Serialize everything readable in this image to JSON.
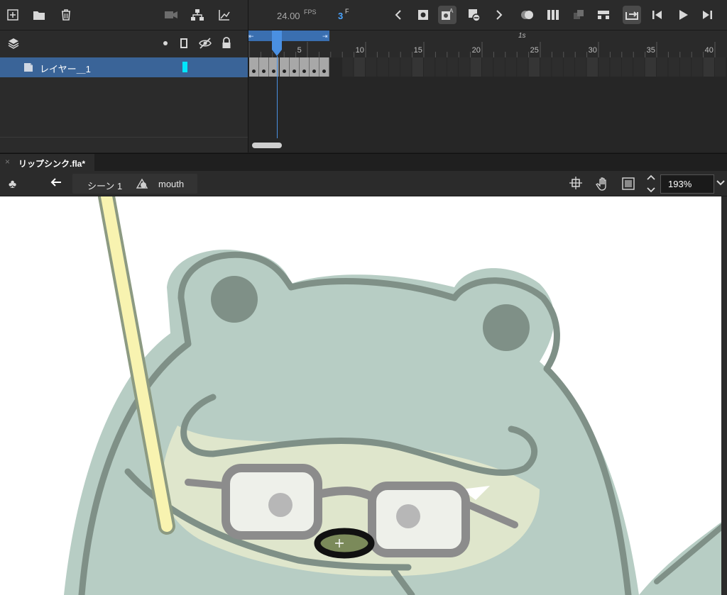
{
  "toolbar": {
    "fps_value": "24.00",
    "fps_label": "FPS",
    "current_frame": "3",
    "frame_suffix": "F"
  },
  "layers": {
    "items": [
      {
        "name": "レイヤー＿1",
        "color": "#00e5ff"
      }
    ]
  },
  "timeline": {
    "seconds_marker": "1s",
    "frame_numbers": [
      "5",
      "10",
      "15",
      "20",
      "25",
      "30",
      "35",
      "40"
    ],
    "keyframe_count": 8
  },
  "document": {
    "tab_title": "リップシンク.fla*"
  },
  "edit_bar": {
    "scene_label": "シーン 1",
    "symbol_label": "mouth",
    "zoom_value": "193%"
  },
  "colors": {
    "accent_blue": "#3a6498",
    "playhead": "#4a90e2",
    "character_fill": "#b7cdc4",
    "character_outline": "#7f9087",
    "face_fill": "#dfe6cc",
    "glasses": "#8c8c8c",
    "stick": "#f8f3b0"
  }
}
